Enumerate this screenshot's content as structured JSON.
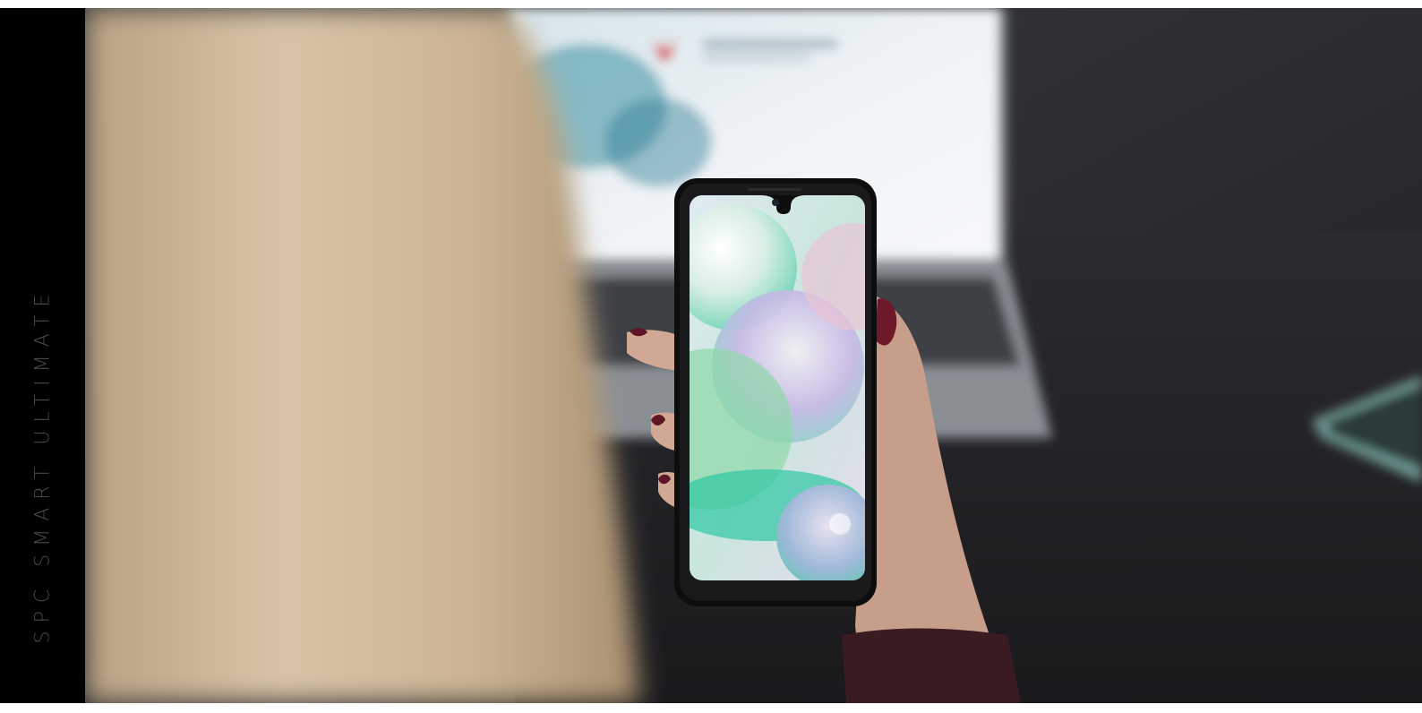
{
  "sidebar": {
    "label": "SPC SMART ULTIMATE"
  },
  "hero": {
    "subject": "phone-in-hand-photo",
    "colors": {
      "background": "#2a2a2d",
      "sidebar": "#000000",
      "sidebar_text": "#4a4a4a",
      "hair": "#cdb79a",
      "laptop_screen": "#e8eef2",
      "phone_body": "#111111"
    }
  }
}
